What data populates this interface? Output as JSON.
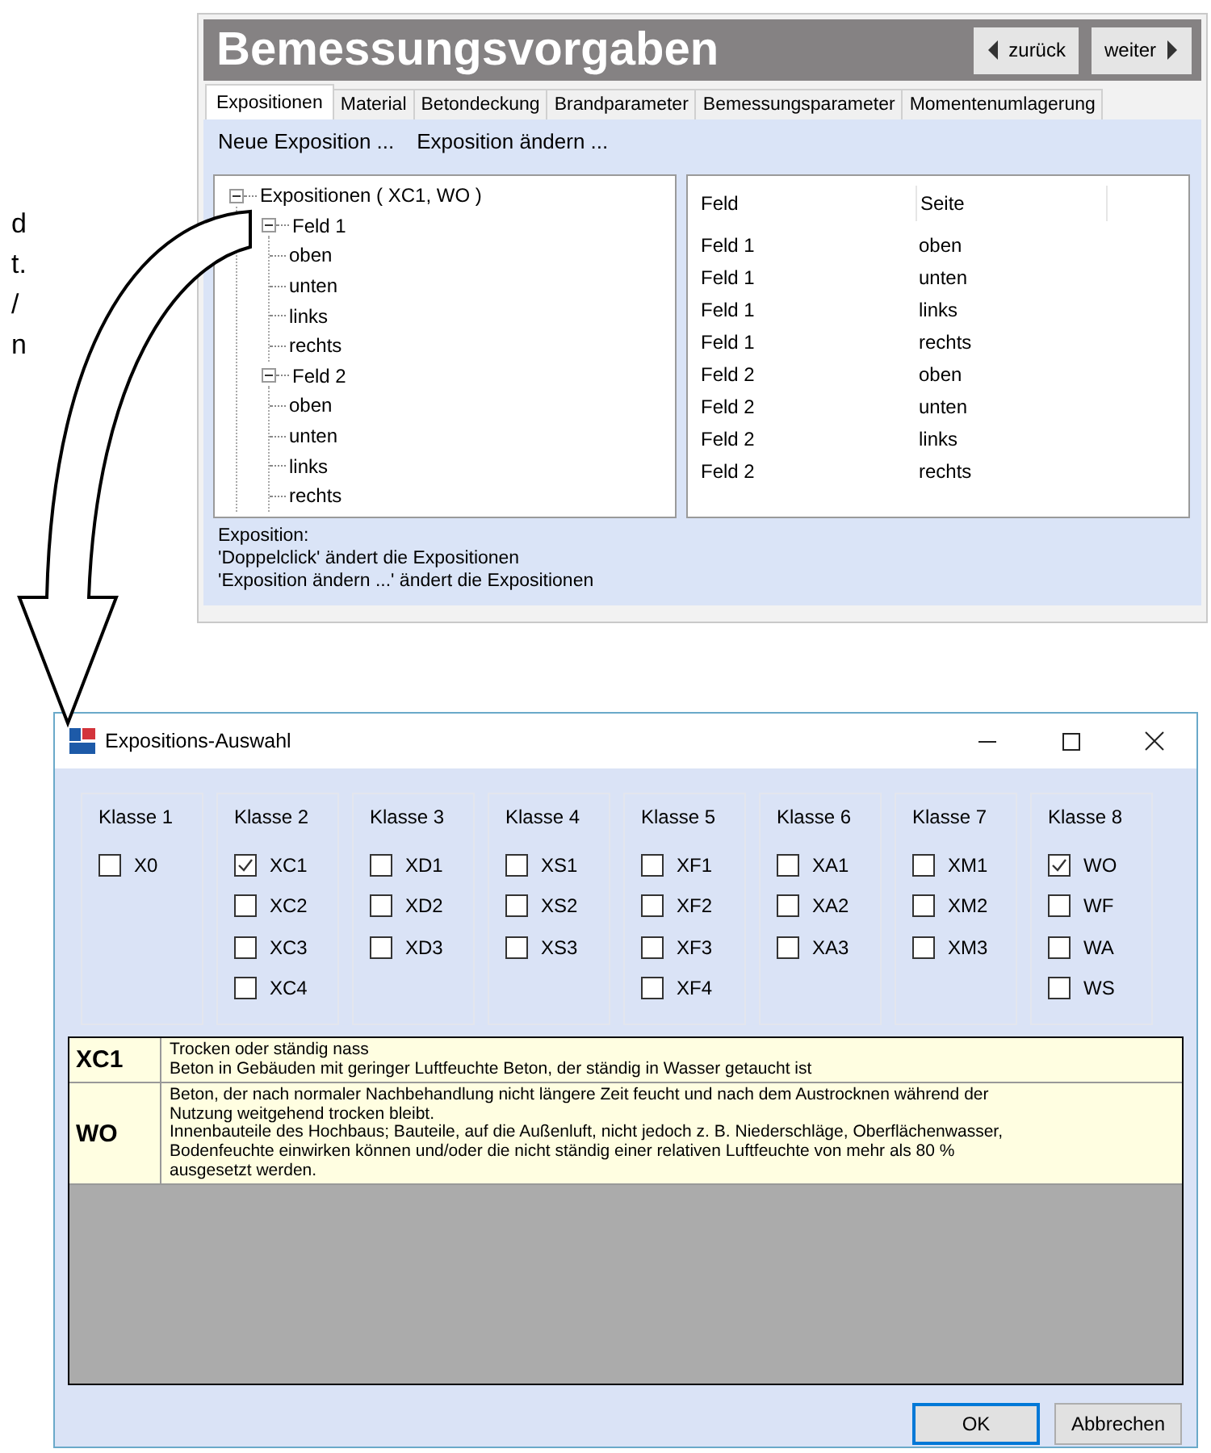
{
  "page_text_fragments": [
    "d",
    "t.",
    "/",
    "n"
  ],
  "main_window": {
    "title": "Bemessungsvorgaben",
    "nav_buttons": [
      {
        "label": "zurück",
        "kind": "back"
      },
      {
        "label": "weiter",
        "kind": "forward"
      }
    ],
    "tabs": [
      {
        "label": "Expositionen",
        "selected": true
      },
      {
        "label": "Material",
        "selected": false
      },
      {
        "label": "Betondeckung",
        "selected": false
      },
      {
        "label": "Brandparameter",
        "selected": false
      },
      {
        "label": "Bemessungsparameter",
        "selected": false
      },
      {
        "label": "Momentenumlagerung",
        "selected": false
      }
    ],
    "toolbar": [
      "Neue Exposition ...",
      "Exposition ändern ..."
    ],
    "tree": [
      {
        "label": "Expositionen ( XC1, WO )",
        "expanded": true,
        "children": [
          {
            "label": "Feld 1",
            "expanded": true,
            "children": [
              {
                "label": "oben"
              },
              {
                "label": "unten"
              },
              {
                "label": "links"
              },
              {
                "label": "rechts"
              }
            ]
          },
          {
            "label": "Feld 2",
            "expanded": true,
            "children": [
              {
                "label": "oben"
              },
              {
                "label": "unten"
              },
              {
                "label": "links"
              },
              {
                "label": "rechts"
              }
            ]
          }
        ]
      }
    ],
    "table": {
      "columns": [
        "Feld",
        "Seite"
      ],
      "rows": [
        [
          "Feld 1",
          "oben"
        ],
        [
          "Feld 1",
          "unten"
        ],
        [
          "Feld 1",
          "links"
        ],
        [
          "Feld 1",
          "rechts"
        ],
        [
          "Feld 2",
          "oben"
        ],
        [
          "Feld 2",
          "unten"
        ],
        [
          "Feld 2",
          "links"
        ],
        [
          "Feld 2",
          "rechts"
        ]
      ]
    },
    "hint_lines": [
      "Exposition:",
      "'Doppelclick' ändert die Expositionen",
      "'Exposition ändern ...' ändert die Expositionen"
    ]
  },
  "dialog": {
    "title": "Expositions-Auswahl",
    "groups": [
      {
        "title": "Klasse 1",
        "options": [
          {
            "label": "X0",
            "checked": false
          }
        ]
      },
      {
        "title": "Klasse 2",
        "options": [
          {
            "label": "XC1",
            "checked": true
          },
          {
            "label": "XC2",
            "checked": false
          },
          {
            "label": "XC3",
            "checked": false
          },
          {
            "label": "XC4",
            "checked": false
          }
        ]
      },
      {
        "title": "Klasse 3",
        "options": [
          {
            "label": "XD1",
            "checked": false
          },
          {
            "label": "XD2",
            "checked": false
          },
          {
            "label": "XD3",
            "checked": false
          }
        ]
      },
      {
        "title": "Klasse 4",
        "options": [
          {
            "label": "XS1",
            "checked": false
          },
          {
            "label": "XS2",
            "checked": false
          },
          {
            "label": "XS3",
            "checked": false
          }
        ]
      },
      {
        "title": "Klasse 5",
        "options": [
          {
            "label": "XF1",
            "checked": false
          },
          {
            "label": "XF2",
            "checked": false
          },
          {
            "label": "XF3",
            "checked": false
          },
          {
            "label": "XF4",
            "checked": false
          }
        ]
      },
      {
        "title": "Klasse 6",
        "options": [
          {
            "label": "XA1",
            "checked": false
          },
          {
            "label": "XA2",
            "checked": false
          },
          {
            "label": "XA3",
            "checked": false
          }
        ]
      },
      {
        "title": "Klasse 7",
        "options": [
          {
            "label": "XM1",
            "checked": false
          },
          {
            "label": "XM2",
            "checked": false
          },
          {
            "label": "XM3",
            "checked": false
          }
        ]
      },
      {
        "title": "Klasse 8",
        "options": [
          {
            "label": "WO",
            "checked": true
          },
          {
            "label": "WF",
            "checked": false
          },
          {
            "label": "WA",
            "checked": false
          },
          {
            "label": "WS",
            "checked": false
          }
        ]
      }
    ],
    "descriptions": [
      {
        "code": "XC1",
        "lines": [
          "Trocken oder ständig nass",
          "Beton in Gebäuden mit geringer Luftfeuchte Beton, der ständig in Wasser getaucht ist"
        ]
      },
      {
        "code": "WO",
        "lines": [
          "Beton, der nach normaler Nachbehandlung nicht längere Zeit feucht und nach dem Austrocknen während der",
          "Nutzung weitgehend trocken bleibt.",
          "Innenbauteile des Hochbaus; Bauteile, auf die Außenluft, nicht jedoch z. B. Niederschläge, Oberflächenwasser,",
          "Bodenfeuchte einwirken können und/oder die nicht ständig einer relativen Luftfeuchte von mehr als 80 %",
          "ausgesetzt werden."
        ]
      }
    ],
    "buttons": [
      {
        "label": "OK",
        "default": true
      },
      {
        "label": "Abbrechen",
        "default": false
      }
    ]
  }
}
